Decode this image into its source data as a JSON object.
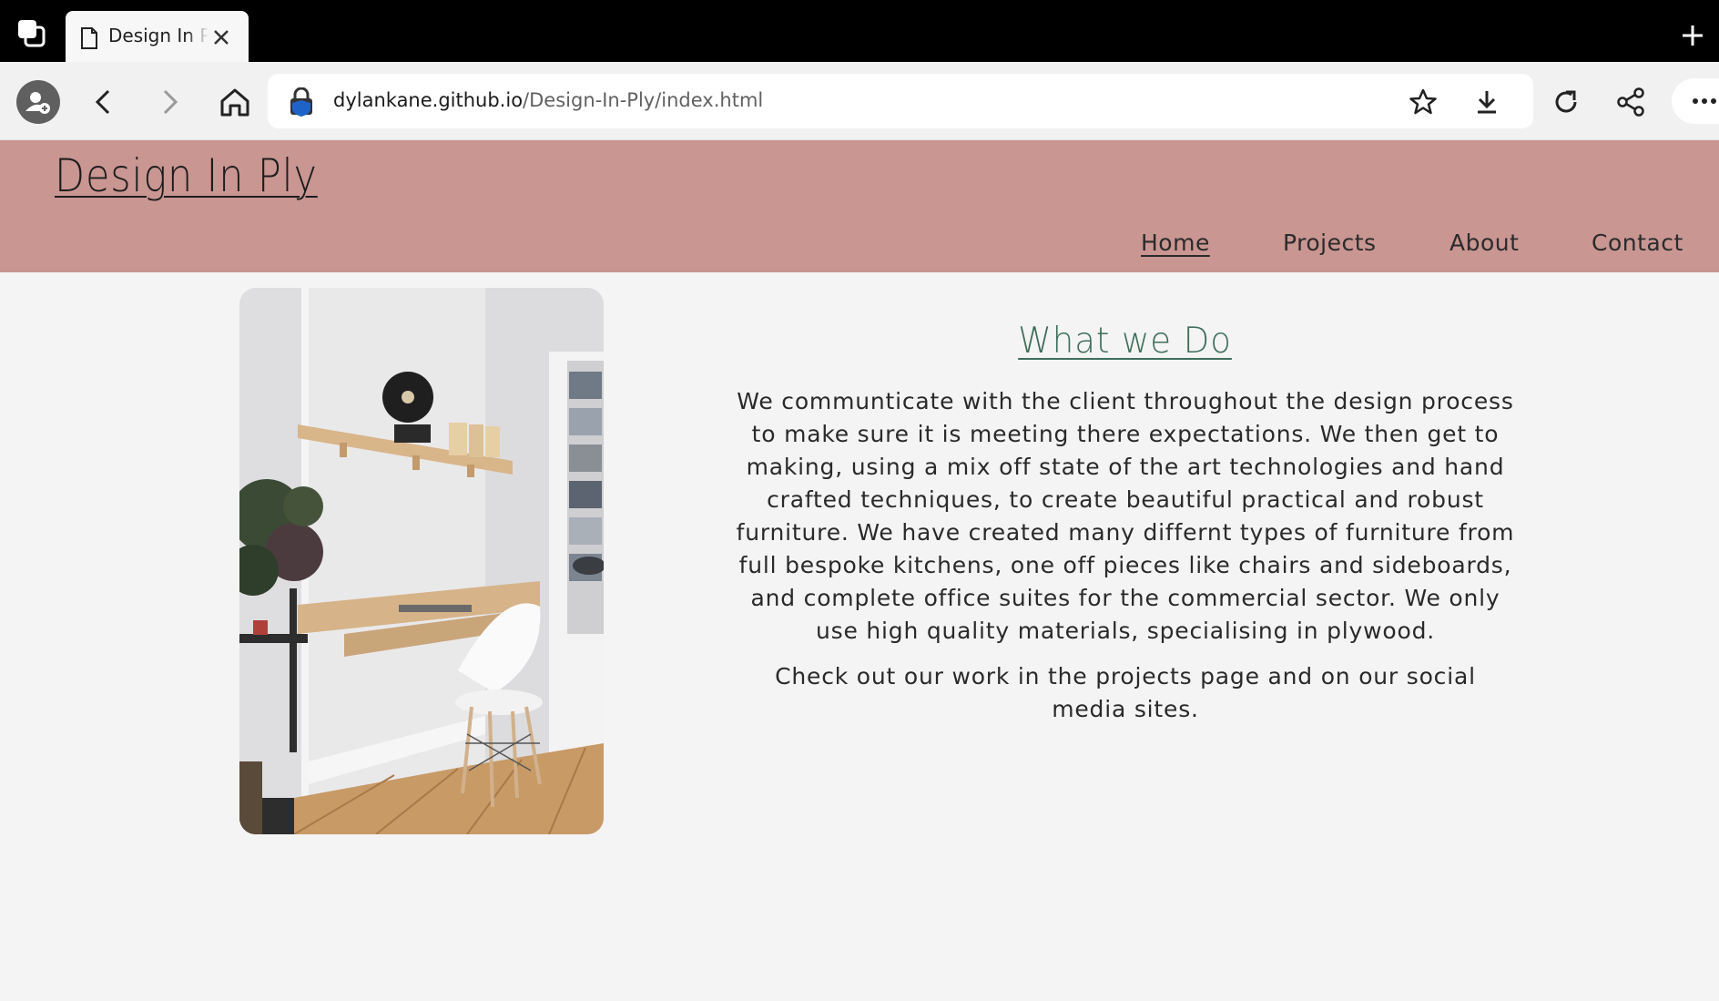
{
  "browser": {
    "tab_title": "Design In Ply",
    "url_host": "dylankane.github.io",
    "url_path": "/Design-In-Ply/index.html"
  },
  "site": {
    "logo": "Design In Ply",
    "nav": {
      "home": "Home",
      "projects": "Projects",
      "about": "About",
      "contact": "Contact"
    }
  },
  "main": {
    "title": "What we Do",
    "paragraph1": "We communticate with the client throughout the design process to make sure it is meeting there expectations. We then get to making, using a mix off state of the art technologies and hand crafted techniques, to create beautiful practical and robust furniture. We have created many differnt types of furniture from full bespoke kitchens, one off pieces like chairs and sideboards, and complete office suites for the commercial sector. We only use high quality materials, specialising in plywood.",
    "paragraph2": "Check out our work in the projects page and on our social media sites."
  },
  "colors": {
    "header_bg": "#c99692",
    "title_green": "#3f6e5b",
    "page_bg": "#f4f4f4"
  },
  "icons": [
    "tab-switcher-icon",
    "page-icon",
    "close-icon",
    "plus-icon",
    "profile-icon",
    "back-icon",
    "forward-icon",
    "home-icon",
    "lock-icon",
    "star-icon",
    "download-icon",
    "reload-icon",
    "share-icon",
    "more-icon"
  ]
}
